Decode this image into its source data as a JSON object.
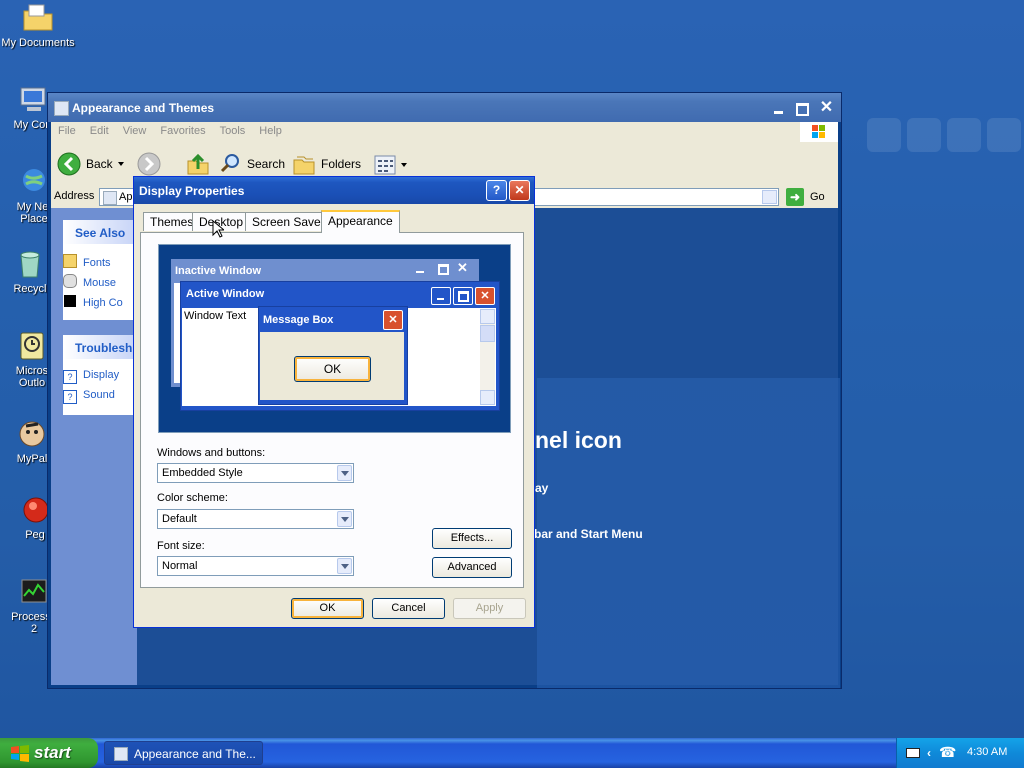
{
  "desktop": {
    "icons": [
      {
        "label": "My Documents",
        "icon": "folder-documents-icon"
      },
      {
        "label": "My Com",
        "icon": "computer-icon"
      },
      {
        "label": "My Net Place",
        "label_lines": [
          "My Net",
          "Place"
        ],
        "icon": "network-places-icon"
      },
      {
        "label": "Recycl",
        "icon": "recycle-bin-icon"
      },
      {
        "label_lines": [
          "Micros",
          "Outlo"
        ],
        "icon": "outlook-icon"
      },
      {
        "label": "MyPal",
        "icon": "mypal-icon"
      },
      {
        "label": "Peg",
        "icon": "peg-icon"
      },
      {
        "label_lines": [
          "Process I",
          "2"
        ],
        "icon": "process-icon"
      }
    ]
  },
  "explorer": {
    "title": "Appearance and Themes",
    "menu": [
      "File",
      "Edit",
      "View",
      "Favorites",
      "Tools",
      "Help"
    ],
    "toolbar": {
      "back": "Back",
      "search": "Search",
      "folders": "Folders"
    },
    "address": {
      "label": "Address",
      "value": "Ap",
      "go": "Go"
    },
    "task_pane": {
      "see_also": {
        "title": "See Also",
        "items": [
          "Fonts",
          "Mouse",
          "High Co"
        ]
      },
      "troubleshooters": {
        "title": "Troublesh",
        "items": [
          "Display",
          "Sound"
        ]
      }
    },
    "content": {
      "heading_fragment": "nel icon",
      "line1": "ay",
      "line2": "bar and Start Menu"
    }
  },
  "dialog": {
    "title": "Display Properties",
    "tabs": [
      "Themes",
      "Desktop",
      "Screen Saver",
      "Appearance"
    ],
    "active_tab": "Appearance",
    "preview": {
      "inactive_title": "Inactive Window",
      "active_title": "Active Window",
      "window_text": "Window Text",
      "msgbox_title": "Message Box",
      "msgbox_ok": "OK"
    },
    "windows_buttons": {
      "label": "Windows and buttons:",
      "value": "Embedded Style"
    },
    "color_scheme": {
      "label": "Color scheme:",
      "value": "Default"
    },
    "font_size": {
      "label": "Font size:",
      "value": "Normal"
    },
    "effects_label": "Effects...",
    "advanced_label": "Advanced",
    "ok_label": "OK",
    "cancel_label": "Cancel",
    "apply_label": "Apply"
  },
  "taskbar": {
    "start_label": "start",
    "task_label": "Appearance and The...",
    "clock": "4:30 AM"
  },
  "colors": {
    "desktop_blue": "#245da8",
    "xp_title_blue": "#1e57c0",
    "xp_close_red": "#c0391c",
    "start_green": "#3fae3f",
    "dialog_face": "#ece9d8"
  }
}
